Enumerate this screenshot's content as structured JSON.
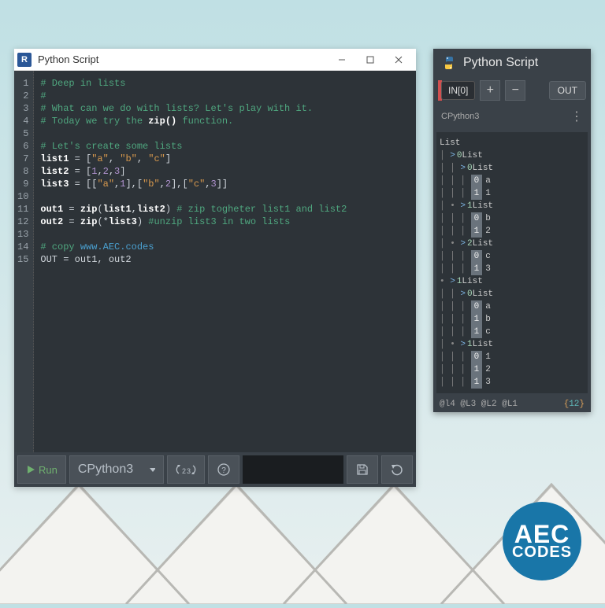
{
  "editor": {
    "app_icon_letter": "R",
    "title": "Python Script",
    "lines": [
      {
        "n": 1,
        "html": "<span class='c-comment'># Deep in lists</span>"
      },
      {
        "n": 2,
        "html": "<span class='c-comment'>#</span>"
      },
      {
        "n": 3,
        "html": "<span class='c-comment'># What can we do with lists? Let's play with it.</span>"
      },
      {
        "n": 4,
        "html": "<span class='c-comment'># Today we try the </span><span class='c-builtin'>zip()</span><span class='c-comment'> function.</span>"
      },
      {
        "n": 5,
        "html": ""
      },
      {
        "n": 6,
        "html": "<span class='c-comment'># Let's create some lists</span>"
      },
      {
        "n": 7,
        "html": "<span class='c-ident'>list1</span> = [<span class='c-string'>\"a\"</span>, <span class='c-string'>\"b\"</span>, <span class='c-string'>\"c\"</span>]"
      },
      {
        "n": 8,
        "html": "<span class='c-ident'>list2</span> = [<span class='c-number'>1</span>,<span class='c-number'>2</span>,<span class='c-number'>3</span>]"
      },
      {
        "n": 9,
        "html": "<span class='c-ident'>list3</span> = [[<span class='c-string'>\"a\"</span>,<span class='c-number'>1</span>],[<span class='c-string'>\"b\"</span>,<span class='c-number'>2</span>],[<span class='c-string'>\"c\"</span>,<span class='c-number'>3</span>]]"
      },
      {
        "n": 10,
        "html": ""
      },
      {
        "n": 11,
        "html": "<span class='c-ident'>out1</span> = <span class='c-builtin'>zip</span>(<span class='c-ident'>list1</span>,<span class='c-ident'>list2</span>) <span class='c-comment'># zip togheter list1 and list2</span>"
      },
      {
        "n": 12,
        "html": "<span class='c-ident'>out2</span> = <span class='c-builtin'>zip</span>(*<span class='c-ident'>list3</span>) <span class='c-comment'>#unzip list3 in two lists</span>"
      },
      {
        "n": 13,
        "html": ""
      },
      {
        "n": 14,
        "html": "<span class='c-comment'># copy </span><span class='c-link'>www.AEC.codes</span>"
      },
      {
        "n": 15,
        "html": "OUT = out1, out2"
      }
    ],
    "toolbar": {
      "run": "Run",
      "engine": "CPython3"
    }
  },
  "node": {
    "title": "Python Script",
    "in_label": "IN[0]",
    "out_label": "OUT",
    "engine": "CPython3",
    "tree": [
      {
        "depth": 0,
        "caret": false,
        "text": "List"
      },
      {
        "depth": 1,
        "caret": true,
        "idx": "0",
        "text": "List"
      },
      {
        "depth": 2,
        "caret": true,
        "idx": "0",
        "text": "List"
      },
      {
        "depth": 3,
        "caret": false,
        "box": "0",
        "text": "a"
      },
      {
        "depth": 3,
        "caret": false,
        "box": "1",
        "text": "1"
      },
      {
        "depth": 2,
        "caret": true,
        "idx": "1",
        "text": "List",
        "dot": true
      },
      {
        "depth": 3,
        "caret": false,
        "box": "0",
        "text": "b"
      },
      {
        "depth": 3,
        "caret": false,
        "box": "1",
        "text": "2"
      },
      {
        "depth": 2,
        "caret": true,
        "idx": "2",
        "text": "List",
        "dot": true
      },
      {
        "depth": 3,
        "caret": false,
        "box": "0",
        "text": "c"
      },
      {
        "depth": 3,
        "caret": false,
        "box": "1",
        "text": "3"
      },
      {
        "depth": 1,
        "caret": true,
        "idx": "1",
        "text": "List",
        "dot": true
      },
      {
        "depth": 2,
        "caret": true,
        "idx": "0",
        "text": "List"
      },
      {
        "depth": 3,
        "caret": false,
        "box": "0",
        "text": "a"
      },
      {
        "depth": 3,
        "caret": false,
        "box": "1",
        "text": "b"
      },
      {
        "depth": 3,
        "caret": false,
        "box": "1",
        "text": "c"
      },
      {
        "depth": 2,
        "caret": true,
        "idx": "1",
        "text": "List",
        "dot": true
      },
      {
        "depth": 3,
        "caret": false,
        "box": "0",
        "text": "1"
      },
      {
        "depth": 3,
        "caret": false,
        "box": "1",
        "text": "2"
      },
      {
        "depth": 3,
        "caret": false,
        "box": "1",
        "text": "3"
      }
    ],
    "status": {
      "left": "@l4 @L3 @L2 @L1",
      "right_open": "{",
      "right_num": "12",
      "right_close": "}"
    }
  },
  "logo": {
    "line1": "AEC",
    "line2": "CODES"
  }
}
